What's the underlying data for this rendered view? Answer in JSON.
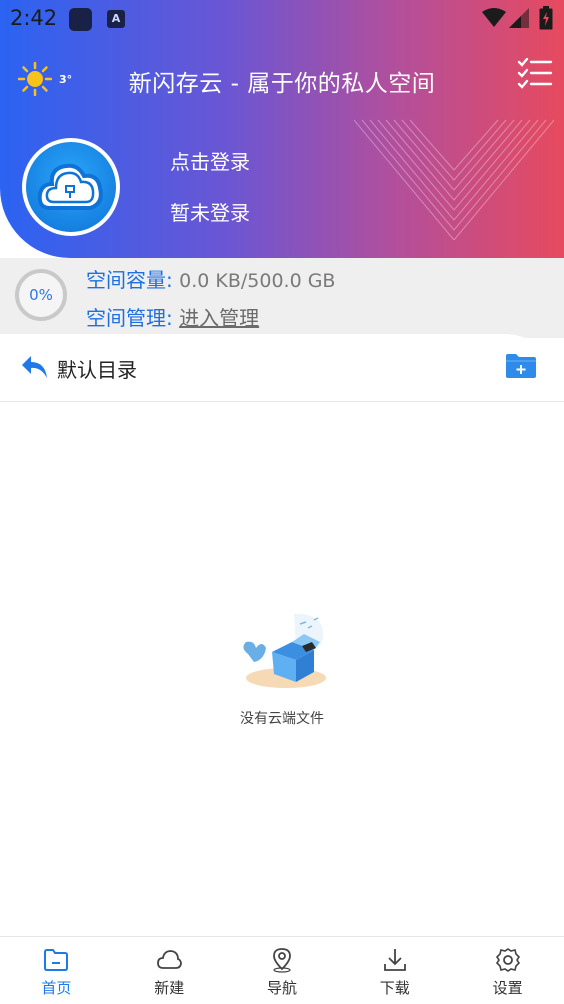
{
  "status_bar": {
    "time": "2:42",
    "notification_badge": "A"
  },
  "header": {
    "weather_temp": "3°",
    "title": "新闪存云 - 属于你的私人空间",
    "login_link": "点击登录",
    "login_status": "暂未登录"
  },
  "storage": {
    "usage_percent": "0%",
    "capacity_label": "空间容量:",
    "capacity_value": "0.0 KB/500.0 GB",
    "manage_label": "空间管理:",
    "manage_link": "进入管理"
  },
  "directory": {
    "title": "默认目录"
  },
  "empty_state": {
    "text": "没有云端文件"
  },
  "bottom_nav": {
    "items": [
      {
        "label": "首页",
        "icon": "folder-icon",
        "active": true
      },
      {
        "label": "新建",
        "icon": "cloud-icon",
        "active": false
      },
      {
        "label": "导航",
        "icon": "location-icon",
        "active": false
      },
      {
        "label": "下载",
        "icon": "download-icon",
        "active": false
      },
      {
        "label": "设置",
        "icon": "gear-icon",
        "active": false
      }
    ]
  },
  "colors": {
    "gradient_start": "#2b63f2",
    "gradient_end": "#e74a5e",
    "accent_blue": "#1f7ae8",
    "weather_sun": "#f7c21a"
  }
}
